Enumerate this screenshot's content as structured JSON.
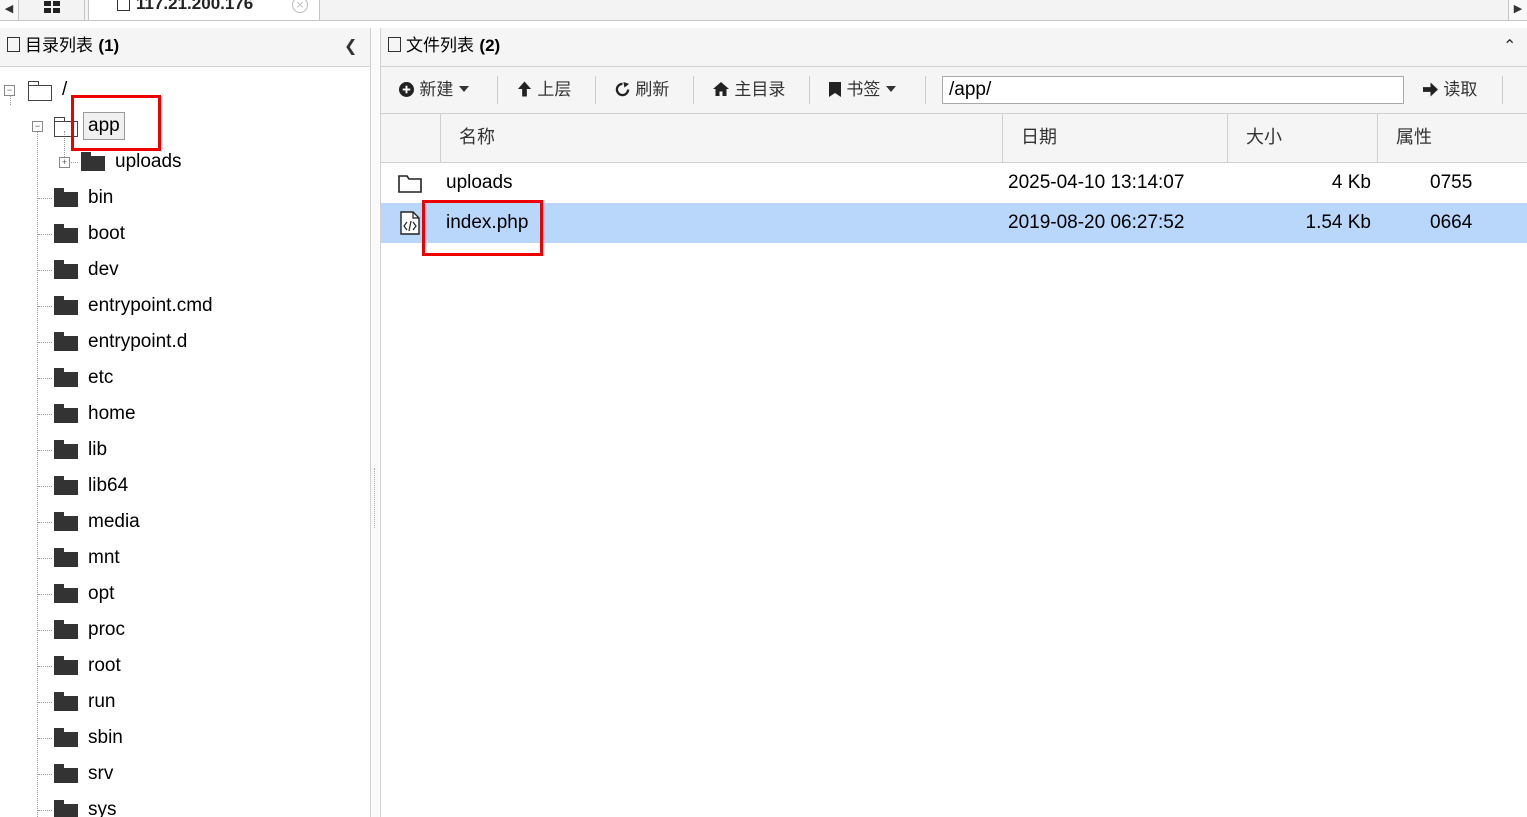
{
  "tab": {
    "label": "117.21.200.176"
  },
  "left": {
    "title": "目录列表",
    "count": "(1)",
    "tree": {
      "root": "/",
      "app": "app",
      "uploads": "uploads",
      "children": [
        "bin",
        "boot",
        "dev",
        "entrypoint.cmd",
        "entrypoint.d",
        "etc",
        "home",
        "lib",
        "lib64",
        "media",
        "mnt",
        "opt",
        "proc",
        "root",
        "run",
        "sbin",
        "srv",
        "sys"
      ]
    }
  },
  "right": {
    "title": "文件列表",
    "count": "(2)",
    "toolbar": {
      "new": "新建",
      "up": "上层",
      "refresh": "刷新",
      "home": "主目录",
      "bookmark": "书签",
      "path": "/app/",
      "read": "读取"
    },
    "columns": {
      "name": "名称",
      "date": "日期",
      "size": "大小",
      "perm": "属性"
    },
    "rows": [
      {
        "name": "uploads",
        "date": "2025-04-10 13:14:07",
        "size": "4 Kb",
        "perm": "0755",
        "type": "folder"
      },
      {
        "name": "index.php",
        "date": "2019-08-20 06:27:52",
        "size": "1.54 Kb",
        "perm": "0664",
        "type": "code-file"
      }
    ]
  }
}
